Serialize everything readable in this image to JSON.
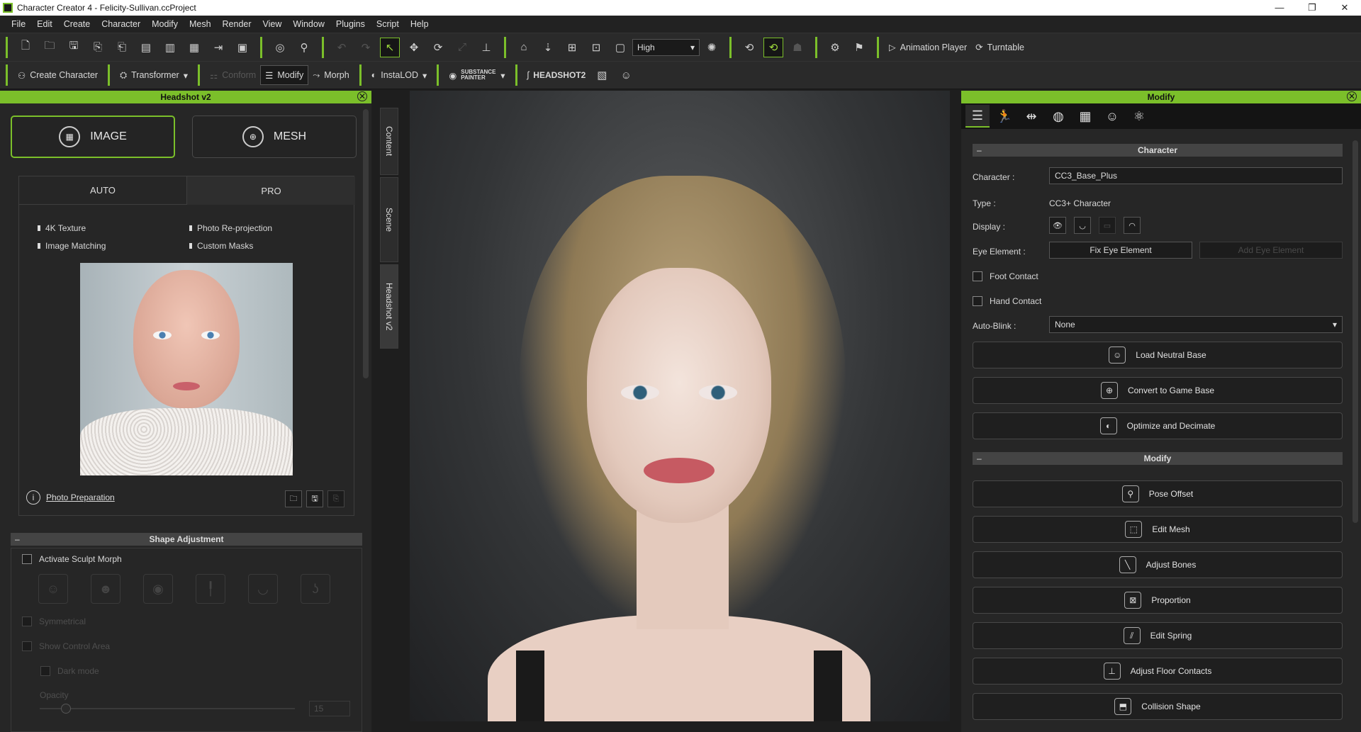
{
  "window": {
    "title": "Character Creator 4 - Felicity-Sullivan.ccProject"
  },
  "menu": [
    "File",
    "Edit",
    "Create",
    "Character",
    "Modify",
    "Mesh",
    "Render",
    "View",
    "Window",
    "Plugins",
    "Script",
    "Help"
  ],
  "toolbar1": {
    "quality": "High",
    "animation_player": "Animation Player",
    "turntable": "Turntable"
  },
  "toolbar2": {
    "create_character": "Create Character",
    "transformer": "Transformer",
    "conform": "Conform",
    "modify": "Modify",
    "morph": "Morph",
    "instalod": "InstaLOD",
    "substance_painter": "SUBSTANCE PAINTER",
    "headshot2": "HEADSHOT2"
  },
  "left": {
    "panel_title": "Headshot v2",
    "image_label": "IMAGE",
    "mesh_label": "MESH",
    "tabs": [
      "AUTO",
      "PRO"
    ],
    "features": [
      "4K Texture",
      "Photo Re-projection",
      "Image Matching",
      "Custom Masks"
    ],
    "photo_prep": "Photo Preparation",
    "shape_adjustment": "Shape Adjustment",
    "activate_sculpt": "Activate Sculpt Morph",
    "symmetrical": "Symmetrical",
    "show_control_area": "Show Control Area",
    "dark_mode": "Dark mode",
    "opacity": "Opacity",
    "opacity_value": "15"
  },
  "vtabs": [
    "Content",
    "Scene",
    "Headshot v2"
  ],
  "right": {
    "panel_title": "Modify",
    "character_section": "Character",
    "character_label": "Character :",
    "character_value": "CC3_Base_Plus",
    "type_label": "Type :",
    "type_value": "CC3+ Character",
    "display_label": "Display :",
    "eye_element_label": "Eye Element :",
    "fix_eye": "Fix Eye Element",
    "add_eye": "Add Eye Element",
    "foot_contact": "Foot Contact",
    "hand_contact": "Hand Contact",
    "autoblink_label": "Auto-Blink :",
    "autoblink_value": "None",
    "load_neutral": "Load Neutral Base",
    "convert_game": "Convert to Game Base",
    "optimize": "Optimize and Decimate",
    "modify_section": "Modify",
    "pose_offset": "Pose Offset",
    "edit_mesh": "Edit Mesh",
    "adjust_bones": "Adjust Bones",
    "proportion": "Proportion",
    "edit_spring": "Edit Spring",
    "adjust_floor": "Adjust Floor Contacts",
    "collision_shape": "Collision Shape"
  },
  "colors": {
    "accent": "#7bbf2a",
    "panel": "#262626",
    "title_bg": "#ffffff"
  }
}
